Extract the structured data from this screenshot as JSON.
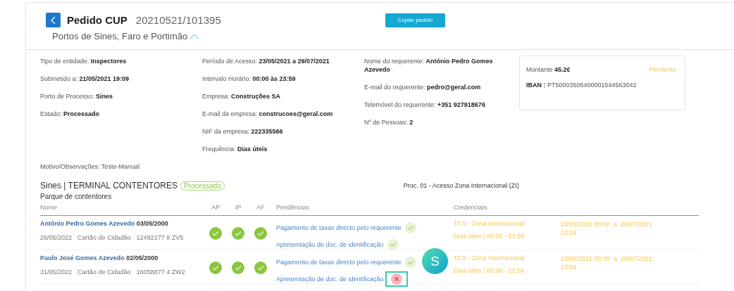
{
  "header": {
    "title": "Pedido CUP",
    "number": "20210521/101395",
    "subtitle": "Portos de Sines, Faro e Portimão",
    "expanded": true,
    "copy_button": "Copiar pedido"
  },
  "details": {
    "columns": [
      [
        {
          "label": "Tipo de entidade:",
          "value": "Inspectores"
        },
        {
          "label": "Submetido a:",
          "value": "21/05/2021 19:09"
        },
        {
          "label": "Porto de Processo:",
          "value": "Sines"
        },
        {
          "label": "Estado:",
          "value": "Processado"
        }
      ],
      [
        {
          "label": "Período de Acesso:",
          "value": "23/05/2021 a 29/07/2021"
        },
        {
          "label": "Intervalo Horário:",
          "value": "00:00 às 23:59"
        },
        {
          "label": "Empresa:",
          "value": "Construções SA"
        },
        {
          "label": "E-mail da empresa:",
          "value": "construcoes@geral.com"
        },
        {
          "label": "NIF da empresa:",
          "value": "222335566"
        },
        {
          "label": "Frequência:",
          "value": "Dias úteis"
        }
      ],
      [
        {
          "label": "Nome do requerente:",
          "value": "António Pedro Gomes Azevedo"
        },
        {
          "label": "E-mail do requerente:",
          "value": "pedro@geral.com"
        },
        {
          "label": "Telemóvel do requerente:",
          "value": "+351 927918676"
        },
        {
          "label": "Nº de Pessoas:",
          "value": "2"
        }
      ]
    ],
    "payment": {
      "amount_label": "Montante",
      "amount": "45.2€",
      "status": "Pendente",
      "iban_label": "IBAN :",
      "iban": "PT50003506400001544563042"
    },
    "note": "Motivo/Observações: Teste-Manual"
  },
  "section": {
    "title": "Sines | TERMINAL CONTENTORES",
    "status": "Processado",
    "area": "Parque de contentores",
    "process": "Proc. 01 - Acesso Zona Internacional (ZI)",
    "columns": [
      "Nome",
      "AP",
      "IP",
      "AF",
      "Pendências",
      "Credenciais"
    ],
    "rows": [
      {
        "name": "António Pedro Gomes Azevedo",
        "birthdate": "03/05/2000",
        "date": "26/05/2022",
        "doc_type": "Cartão de Cidadão",
        "doc_number": "12492177 9 ZV5",
        "checks": [
          {
            "ok": true
          },
          {
            "ok": true
          },
          {
            "ok": true
          }
        ],
        "pending": [
          {
            "text": "Pagamento de taxas directo pelo requerente",
            "ok": true,
            "focused": false
          },
          {
            "text": "Apresentação de doc. de identificação",
            "ok": true,
            "focused": false
          }
        ],
        "credential": "TCS - Zona Internacional",
        "schedule": "Dias úteis | 00:00 - 23:59",
        "period": "23/05/2021 00:00  a  29/07/2021 23:59"
      },
      {
        "name": "Paulo José Gomes Azevedo",
        "birthdate": "02/05/2000",
        "date": "31/05/2022",
        "doc_type": "Cartão de Cidadão",
        "doc_number": "16058877 4 ZW2",
        "checks": [
          {
            "ok": true
          },
          {
            "ok": true
          },
          {
            "ok": true
          }
        ],
        "pending": [
          {
            "text": "Pagamento de taxas directo pelo requerente",
            "ok": true,
            "focused": false
          },
          {
            "text": "Apresentação de doc. de identificação",
            "ok": false,
            "focused": true
          }
        ],
        "credential": "TCS - Zona Internacional",
        "schedule": "Dias úteis | 00:00 - 23:59",
        "period": "23/05/2021 00:00  a  29/07/2021 23:59"
      }
    ]
  },
  "avatar": "S"
}
